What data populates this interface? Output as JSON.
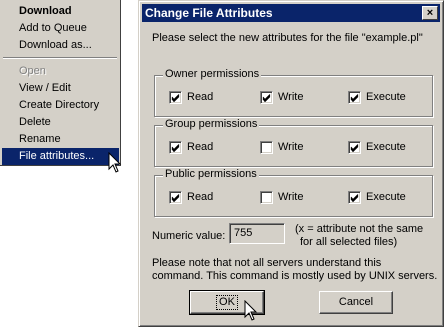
{
  "context_menu": {
    "items": [
      {
        "label": "Download",
        "bold": true
      },
      {
        "label": "Add to Queue"
      },
      {
        "label": "Download as..."
      },
      {
        "label": "Open",
        "disabled": true
      },
      {
        "label": "View / Edit"
      },
      {
        "label": "Create Directory"
      },
      {
        "label": "Delete"
      },
      {
        "label": "Rename"
      },
      {
        "label": "File attributes...",
        "selected": true
      }
    ]
  },
  "dialog": {
    "title": "Change File Attributes",
    "close_symbol": "×",
    "intro": "Please select the new attributes for the file \"example.pl\"",
    "groups": [
      {
        "legend": "Owner permissions",
        "options": [
          {
            "label": "Read",
            "checked": true
          },
          {
            "label": "Write",
            "checked": true
          },
          {
            "label": "Execute",
            "checked": true
          }
        ]
      },
      {
        "legend": "Group permissions",
        "options": [
          {
            "label": "Read",
            "checked": true
          },
          {
            "label": "Write",
            "checked": false
          },
          {
            "label": "Execute",
            "checked": true
          }
        ]
      },
      {
        "legend": "Public permissions",
        "options": [
          {
            "label": "Read",
            "checked": true
          },
          {
            "label": "Write",
            "checked": false
          },
          {
            "label": "Execute",
            "checked": true
          }
        ]
      }
    ],
    "numeric_label": "Numeric value:",
    "numeric_value": "755",
    "numeric_hint_line1": "(x = attribute not the same",
    "numeric_hint_line2": "for all selected files)",
    "note_line1": "Please note that not all servers understand this",
    "note_line2": "command. This command is mostly used by UNIX servers.",
    "ok_label": "OK",
    "cancel_label": "Cancel"
  },
  "colors": {
    "face": "#d4d0c8",
    "highlight": "#0a246a"
  }
}
